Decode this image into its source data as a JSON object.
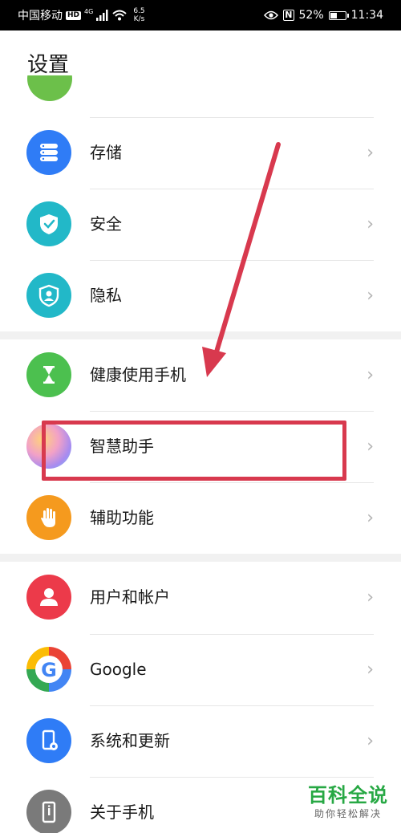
{
  "status_bar": {
    "carrier": "中国移动",
    "hd": "HD",
    "network": "4G",
    "speed_value": "6.5",
    "speed_unit": "K/s",
    "battery_percent_text": "52%",
    "battery_level": 0.52,
    "nfc": "N",
    "time": "11:34"
  },
  "header": {
    "title": "设置"
  },
  "sections": [
    {
      "items": [
        {
          "label": "存储",
          "icon": "storage-icon",
          "color": "#2f7cf6"
        },
        {
          "label": "安全",
          "icon": "shield-check-icon",
          "color": "#22b8c8"
        },
        {
          "label": "隐私",
          "icon": "privacy-icon",
          "color": "#22b8c8"
        }
      ]
    },
    {
      "items": [
        {
          "label": "健康使用手机",
          "icon": "hourglass-icon",
          "color": "#4cc04f"
        },
        {
          "label": "智慧助手",
          "icon": "assistant-icon",
          "color": "#e9a0c8"
        },
        {
          "label": "辅助功能",
          "icon": "hand-icon",
          "color": "#f59a1e"
        }
      ]
    },
    {
      "items": [
        {
          "label": "用户和帐户",
          "icon": "user-icon",
          "color": "#ec3a4a"
        },
        {
          "label": "Google",
          "icon": "google-icon",
          "color": "#ffffff"
        },
        {
          "label": "系统和更新",
          "icon": "phone-settings-icon",
          "color": "#2f7cf6"
        },
        {
          "label": "关于手机",
          "icon": "phone-info-icon",
          "color": "#7a7a7a"
        }
      ]
    }
  ],
  "chevron": "›",
  "watermark": {
    "title": "百科全说",
    "subtitle": "助你轻松解决"
  },
  "colors": {
    "annotation": "#d8394e",
    "watermark": "#27a844"
  }
}
